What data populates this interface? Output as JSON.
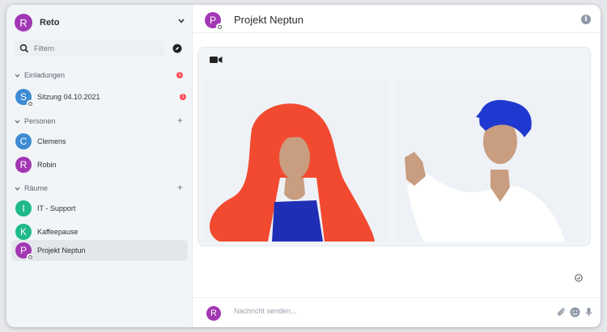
{
  "colors": {
    "accent_purple": "#a237b3",
    "blue": "#3d8bd3",
    "green": "#1fb98a",
    "badge_red": "#ff4b55"
  },
  "account": {
    "initial": "R",
    "name": "Reto"
  },
  "filter": {
    "placeholder": "Filtern"
  },
  "sections": {
    "invites": {
      "label": "Einladungen",
      "badge": "1"
    },
    "people": {
      "label": "Personen"
    },
    "rooms": {
      "label": "Räume"
    }
  },
  "invites": [
    {
      "initial": "S",
      "label": "Sitzung 04.10.2021",
      "badge": "1"
    }
  ],
  "people": [
    {
      "initial": "C",
      "label": "Clemens"
    },
    {
      "initial": "R",
      "label": "Robin"
    }
  ],
  "rooms": [
    {
      "initial": "I",
      "label": "IT - Support"
    },
    {
      "initial": "K",
      "label": "Kaffeepause"
    },
    {
      "initial": "P",
      "label": "Projekt Neptun"
    }
  ],
  "header": {
    "initial": "P",
    "title": "Projekt Neptun"
  },
  "composer": {
    "initial": "R",
    "placeholder": "Nachricht senden..."
  },
  "icons": {
    "info": "info-icon",
    "video": "video-camera-icon",
    "attach": "paperclip-icon",
    "emoji": "emoji-icon",
    "mic": "microphone-icon",
    "read": "check-circle-icon"
  }
}
